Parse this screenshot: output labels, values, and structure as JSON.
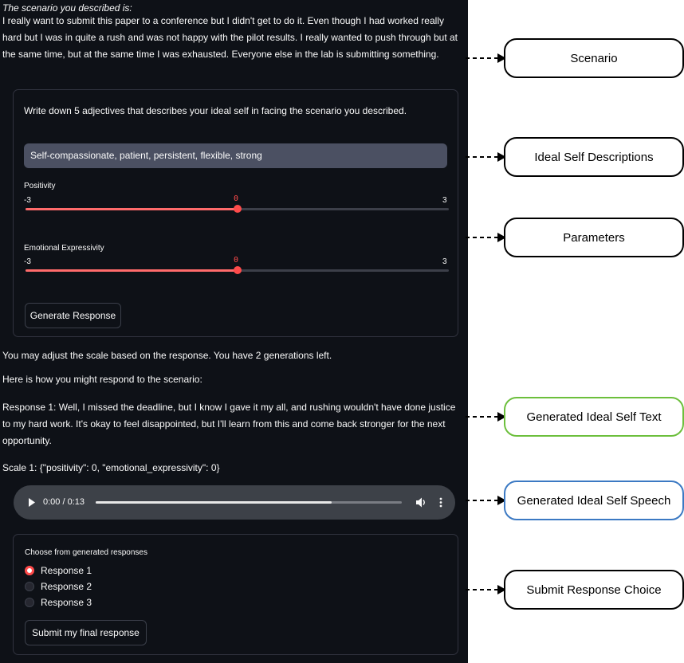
{
  "intro": "The scenario you described is:",
  "scenario_text": "I really want to submit this paper to a conference but I didn't get to do it. Even though I had worked really hard but I was in quite a rush and was not happy with the pilot results. I really wanted to push through but at the same time, but at the same time I was exhausted. Everyone else in the lab is submitting something.",
  "form": {
    "prompt": "Write down 5 adjectives that describes your ideal self in facing the scenario you described.",
    "descriptions_value": "Self-compassionate, patient, persistent, flexible, strong",
    "sliders": [
      {
        "label": "Positivity",
        "value": "0",
        "min": "-3",
        "max": "3"
      },
      {
        "label": "Emotional Expressivity",
        "value": "0",
        "min": "-3",
        "max": "3"
      }
    ],
    "generate_label": "Generate Response"
  },
  "adjust_note": "You may adjust the scale based on the response. You have 2 generations left.",
  "response_intro": "Here is how you might respond to the scenario:",
  "response_text": "Response 1: Well, I missed the deadline, but I know I gave it my all, and rushing wouldn't have done justice to my hard work. It's okay to feel disappointed, but I'll learn from this and come back stronger for the next opportunity.",
  "scale_text": "Scale 1: {\"positivity\": 0, \"emotional_expressivity\": 0}",
  "audio": {
    "time": "0:00 / 0:13",
    "progress": 0.77
  },
  "choice": {
    "label": "Choose from generated responses",
    "options": [
      "Response 1",
      "Response 2",
      "Response 3"
    ],
    "selected_index": 0,
    "submit_label": "Submit my final response"
  },
  "callouts": [
    "Scenario",
    "Ideal Self Descriptions",
    "Parameters",
    "Generated Ideal Self Text",
    "Generated Ideal Self Speech",
    "Submit Response Choice"
  ],
  "colors": {
    "background": "#0e1117",
    "accent": "#ff4b4b",
    "slider_fill": "#ff6b6b",
    "field": "#4b5062",
    "audio_bar": "#3d4148",
    "callout_text_border": "#6cbf3c",
    "callout_speech_border": "#3b79c3"
  }
}
